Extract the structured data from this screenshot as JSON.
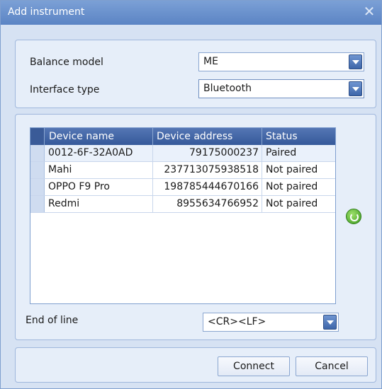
{
  "window": {
    "title": "Add instrument",
    "close_glyph": "✕"
  },
  "settings": {
    "balance_model": {
      "label": "Balance model",
      "value": "ME"
    },
    "interface_type": {
      "label": "Interface type",
      "value": "Bluetooth"
    }
  },
  "devices": {
    "columns": [
      "Device name",
      "Device address",
      "Status"
    ],
    "rows": [
      {
        "name": "0012-6F-32A0AD",
        "address": "79175000237",
        "status": "Paired"
      },
      {
        "name": "Mahi",
        "address": "237713075938518",
        "status": "Not paired"
      },
      {
        "name": "OPPO F9 Pro",
        "address": "198785444670166",
        "status": "Not paired"
      },
      {
        "name": "Redmi",
        "address": "8955634766952",
        "status": "Not paired"
      }
    ],
    "refresh_icon": "refresh-icon"
  },
  "end_of_line": {
    "label": "End of line",
    "value": "<CR><LF>"
  },
  "buttons": {
    "connect": "Connect",
    "cancel": "Cancel"
  }
}
